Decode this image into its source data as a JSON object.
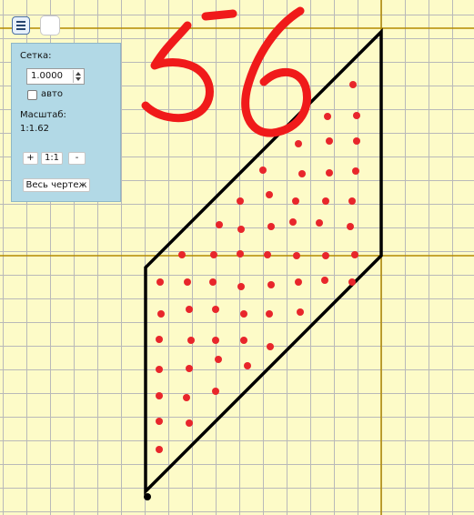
{
  "toolbar": {
    "menu_icon": "hamburger-menu-icon"
  },
  "settings_panel": {
    "grid_label": "Сетка:",
    "grid_value": "1.0000",
    "auto_label": "авто",
    "auto_checked": false,
    "scale_label": "Масштаб:",
    "scale_value": "1:1.62",
    "zoom_in_label": "+",
    "zoom_reset_label": "1:1",
    "zoom_out_label": "-",
    "fit_all_label": "Весь чертеж"
  },
  "drawing": {
    "handwritten_text": "56",
    "colors": {
      "background": "#fdfbc8",
      "grid": "#b9b9b9",
      "axis": "#b38a00",
      "shape": "#000000",
      "dots": "#e8262b",
      "handwriting": "#f01a1a"
    },
    "dot_count": 61
  }
}
